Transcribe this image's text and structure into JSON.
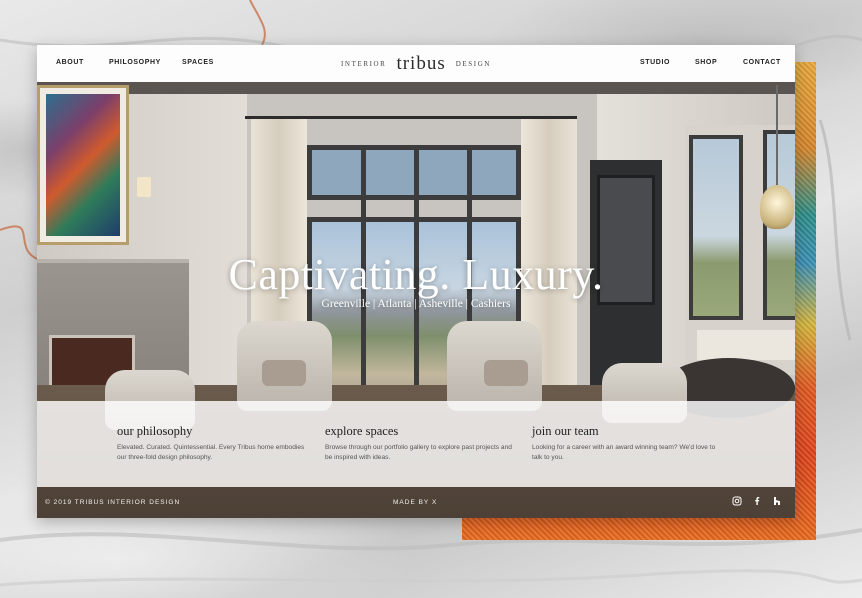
{
  "nav": {
    "left_links": [
      "ABOUT",
      "PHILOSOPHY",
      "SPACES"
    ],
    "right_links": [
      "STUDIO",
      "SHOP",
      "CONTACT"
    ],
    "logo_prefix": "INTERIOR",
    "logo_main": "tribus",
    "logo_suffix": "DESIGN"
  },
  "hero": {
    "title": "Captivating. Luxury.",
    "locations": "Greenville | Atlanta | Asheville | Cashiers"
  },
  "panel": {
    "columns": [
      {
        "heading": "our philosophy",
        "text": "Elevated. Curated. Quintessential. Every Tribus home embodies our three-fold design philosophy."
      },
      {
        "heading": "explore spaces",
        "text": "Browse through our portfolio gallery to explore past projects and be inspired with ideas."
      },
      {
        "heading": "join our team",
        "text": "Looking for a career with an award winning team? We'd love to talk to you."
      }
    ]
  },
  "footer": {
    "copyright": "© 2019 TRIBUS INTERIOR DESIGN",
    "made_by": "MADE BY X",
    "social_icons": [
      "instagram-icon",
      "facebook-icon",
      "houzz-icon"
    ]
  },
  "colors": {
    "accent_orange": "#e0431a",
    "accent_teal": "#2c8f8a",
    "text_dark": "#222222"
  }
}
